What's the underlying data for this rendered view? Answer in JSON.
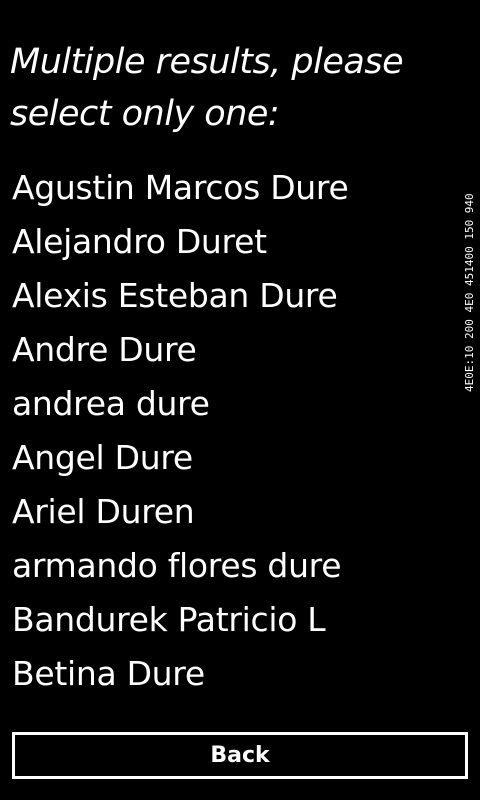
{
  "prompt": "Multiple results, please select only one:",
  "results": [
    "Agustin Marcos Dure",
    "Alejandro Duret",
    "Alexis Esteban Dure",
    "Andre Dure",
    "andrea dure",
    "Angel Dure",
    "Ariel Duren",
    "armando flores dure",
    "Bandurek Patricio L",
    "Betina Dure"
  ],
  "back_label": "Back",
  "debug_overlay": "4E0E:10 200 4E0 451400 150 940"
}
